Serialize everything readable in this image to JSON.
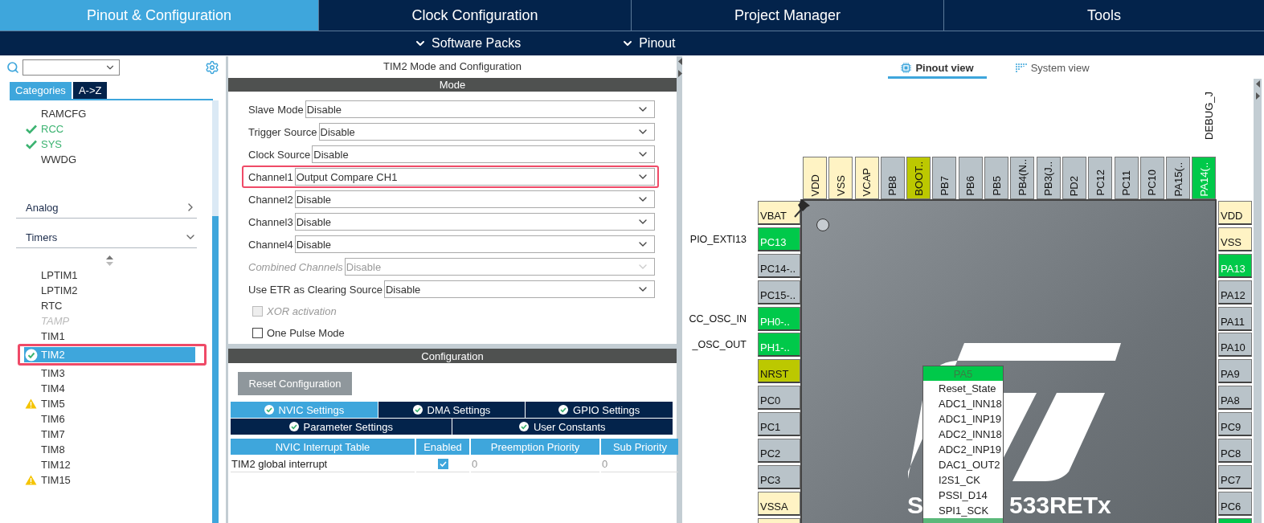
{
  "top_tabs": [
    {
      "label": "Pinout & Configuration",
      "selected": true
    },
    {
      "label": "Clock Configuration",
      "selected": false
    },
    {
      "label": "Project Manager",
      "selected": false
    },
    {
      "label": "Tools",
      "selected": false
    }
  ],
  "sub_menu": [
    "Software Packs",
    "Pinout"
  ],
  "sidebar": {
    "category_tabs": [
      {
        "label": "Categories",
        "selected": true
      },
      {
        "label": "A->Z",
        "selected": false
      }
    ],
    "items_above": [
      {
        "label": "RAMCFG",
        "kind": "plain"
      },
      {
        "label": "RCC",
        "kind": "configured"
      },
      {
        "label": "SYS",
        "kind": "configured"
      },
      {
        "label": "WWDG",
        "kind": "plain"
      }
    ],
    "categories": [
      {
        "label": "Analog",
        "expanded": false
      },
      {
        "label": "Timers",
        "expanded": true,
        "items": [
          {
            "label": "LPTIM1",
            "kind": "plain",
            "selected": false,
            "disabled": false,
            "highlighted": false
          },
          {
            "label": "LPTIM2",
            "kind": "plain",
            "selected": false,
            "disabled": false,
            "highlighted": false
          },
          {
            "label": "RTC",
            "kind": "plain",
            "selected": false,
            "disabled": false,
            "highlighted": false
          },
          {
            "label": "TAMP",
            "kind": "plain",
            "selected": false,
            "disabled": true,
            "highlighted": false
          },
          {
            "label": "TIM1",
            "kind": "plain",
            "selected": false,
            "disabled": false,
            "highlighted": false
          },
          {
            "label": "TIM2",
            "kind": "configured",
            "selected": true,
            "disabled": false,
            "highlighted": true
          },
          {
            "label": "TIM3",
            "kind": "plain",
            "selected": false,
            "disabled": false,
            "highlighted": false
          },
          {
            "label": "TIM4",
            "kind": "plain",
            "selected": false,
            "disabled": false,
            "highlighted": false
          },
          {
            "label": "TIM5",
            "kind": "warning",
            "selected": false,
            "disabled": false,
            "highlighted": false
          },
          {
            "label": "TIM6",
            "kind": "plain",
            "selected": false,
            "disabled": false,
            "highlighted": false
          },
          {
            "label": "TIM7",
            "kind": "plain",
            "selected": false,
            "disabled": false,
            "highlighted": false
          },
          {
            "label": "TIM8",
            "kind": "plain",
            "selected": false,
            "disabled": false,
            "highlighted": false
          },
          {
            "label": "TIM12",
            "kind": "plain",
            "selected": false,
            "disabled": false,
            "highlighted": false
          },
          {
            "label": "TIM15",
            "kind": "warning",
            "selected": false,
            "disabled": false,
            "highlighted": false
          }
        ]
      }
    ]
  },
  "mode_panel": {
    "title": "TIM2 Mode and Configuration",
    "section": "Mode",
    "fields": [
      {
        "label": "Slave Mode",
        "value": "Disable",
        "disabled": false,
        "highlighted": false
      },
      {
        "label": "Trigger Source",
        "value": "Disable",
        "disabled": false,
        "highlighted": false
      },
      {
        "label": "Clock Source",
        "value": "Disable",
        "disabled": false,
        "highlighted": false
      },
      {
        "label": "Channel1",
        "value": "Output Compare CH1",
        "disabled": false,
        "highlighted": true
      },
      {
        "label": "Channel2",
        "value": "Disable",
        "disabled": false,
        "highlighted": false
      },
      {
        "label": "Channel3",
        "value": "Disable",
        "disabled": false,
        "highlighted": false
      },
      {
        "label": "Channel4",
        "value": "Disable",
        "disabled": false,
        "highlighted": false
      },
      {
        "label": "Combined Channels",
        "value": "Disable",
        "disabled": true,
        "highlighted": false
      },
      {
        "label": "Use ETR as Clearing Source",
        "value": "Disable",
        "disabled": false,
        "highlighted": false
      }
    ],
    "options": [
      {
        "label": "XOR activation",
        "checked": false,
        "disabled": true
      },
      {
        "label": "One Pulse Mode",
        "checked": false,
        "disabled": false
      }
    ]
  },
  "config_panel": {
    "section": "Configuration",
    "reset_button": "Reset Configuration",
    "tab_rows": [
      [
        {
          "label": "NVIC Settings",
          "selected": true
        },
        {
          "label": "DMA Settings",
          "selected": false
        },
        {
          "label": "GPIO Settings",
          "selected": false
        }
      ],
      [
        {
          "label": "Parameter Settings",
          "selected": false
        },
        {
          "label": "User Constants",
          "selected": false
        }
      ]
    ],
    "table": {
      "columns": [
        "NVIC Interrupt Table",
        "Enabled",
        "Preemption Priority",
        "Sub Priority"
      ],
      "rows": [
        {
          "name": "TIM2 global interrupt",
          "enabled": true,
          "preemption": "0",
          "sub": "0"
        }
      ]
    }
  },
  "pinout": {
    "view_tabs": [
      {
        "label": "Pinout view",
        "selected": true
      },
      {
        "label": "System view",
        "selected": false
      }
    ],
    "top_signal": "DEBUG_J",
    "top_pins": [
      {
        "name": "VDD",
        "color": "#fff3c4"
      },
      {
        "name": "VSS",
        "color": "#fff3c4"
      },
      {
        "name": "VCAP",
        "color": "#fff3c4"
      },
      {
        "name": "PB8",
        "color": "#b9c3c9"
      },
      {
        "name": "BOOT..",
        "color": "#bcc800"
      },
      {
        "name": "PB7",
        "color": "#b9c3c9"
      },
      {
        "name": "PB6",
        "color": "#b9c3c9"
      },
      {
        "name": "PB5",
        "color": "#b9c3c9"
      },
      {
        "name": "PB4(N..",
        "color": "#b9c3c9"
      },
      {
        "name": "PB3(J..",
        "color": "#b9c3c9"
      },
      {
        "name": "PD2",
        "color": "#b9c3c9"
      },
      {
        "name": "PC12",
        "color": "#b9c3c9"
      },
      {
        "name": "PC11",
        "color": "#b9c3c9"
      },
      {
        "name": "PC10",
        "color": "#b9c3c9"
      },
      {
        "name": "PA15(..",
        "color": "#b9c3c9"
      },
      {
        "name": "PA14(..",
        "color": "#00c94a"
      }
    ],
    "left_pins": [
      {
        "name": "VBAT",
        "color": "#fff3c4"
      },
      {
        "name": "PC13",
        "color": "#00c94a",
        "signal": "PIO_EXTI13"
      },
      {
        "name": "PC14-..",
        "color": "#b9c3c9"
      },
      {
        "name": "PC15-..",
        "color": "#b9c3c9"
      },
      {
        "name": "PH0-..",
        "color": "#00c94a",
        "signal": "CC_OSC_IN"
      },
      {
        "name": "PH1-..",
        "color": "#00c94a",
        "signal": "_OSC_OUT"
      },
      {
        "name": "NRST",
        "color": "#bcc800"
      },
      {
        "name": "PC0",
        "color": "#b9c3c9"
      },
      {
        "name": "PC1",
        "color": "#b9c3c9"
      },
      {
        "name": "PC2",
        "color": "#b9c3c9"
      },
      {
        "name": "PC3",
        "color": "#b9c3c9"
      },
      {
        "name": "VSSA",
        "color": "#fff3c4"
      },
      {
        "color": "#fff3c4"
      }
    ],
    "right_pins": [
      {
        "name": "VDD",
        "color": "#fff3c4"
      },
      {
        "name": "VSS",
        "color": "#fff3c4"
      },
      {
        "name": "PA13",
        "color": "#00c94a"
      },
      {
        "name": "PA12",
        "color": "#b9c3c9"
      },
      {
        "name": "PA11",
        "color": "#b9c3c9"
      },
      {
        "name": "PA10",
        "color": "#b9c3c9"
      },
      {
        "name": "PA9",
        "color": "#b9c3c9"
      },
      {
        "name": "PA8",
        "color": "#b9c3c9"
      },
      {
        "name": "PC9",
        "color": "#b9c3c9"
      },
      {
        "name": "PC8",
        "color": "#b9c3c9"
      },
      {
        "name": "PC7",
        "color": "#b9c3c9"
      },
      {
        "name": "PC6",
        "color": "#b9c3c9"
      },
      {
        "color": "#00c94a"
      }
    ],
    "chip_label_parts": [
      "S",
      "533RETx"
    ],
    "pin_menu": {
      "pin": "PA5",
      "options": [
        {
          "label": "Reset_State",
          "selected": false
        },
        {
          "label": "ADC1_INN18",
          "selected": false
        },
        {
          "label": "ADC1_INP19",
          "selected": false
        },
        {
          "label": "ADC2_INN18",
          "selected": false
        },
        {
          "label": "ADC2_INP19",
          "selected": false
        },
        {
          "label": "DAC1_OUT2",
          "selected": false
        },
        {
          "label": "I2S1_CK",
          "selected": false
        },
        {
          "label": "PSSI_D14",
          "selected": false
        },
        {
          "label": "SPI1_SCK",
          "selected": false
        },
        {
          "selected": true
        }
      ]
    }
  }
}
